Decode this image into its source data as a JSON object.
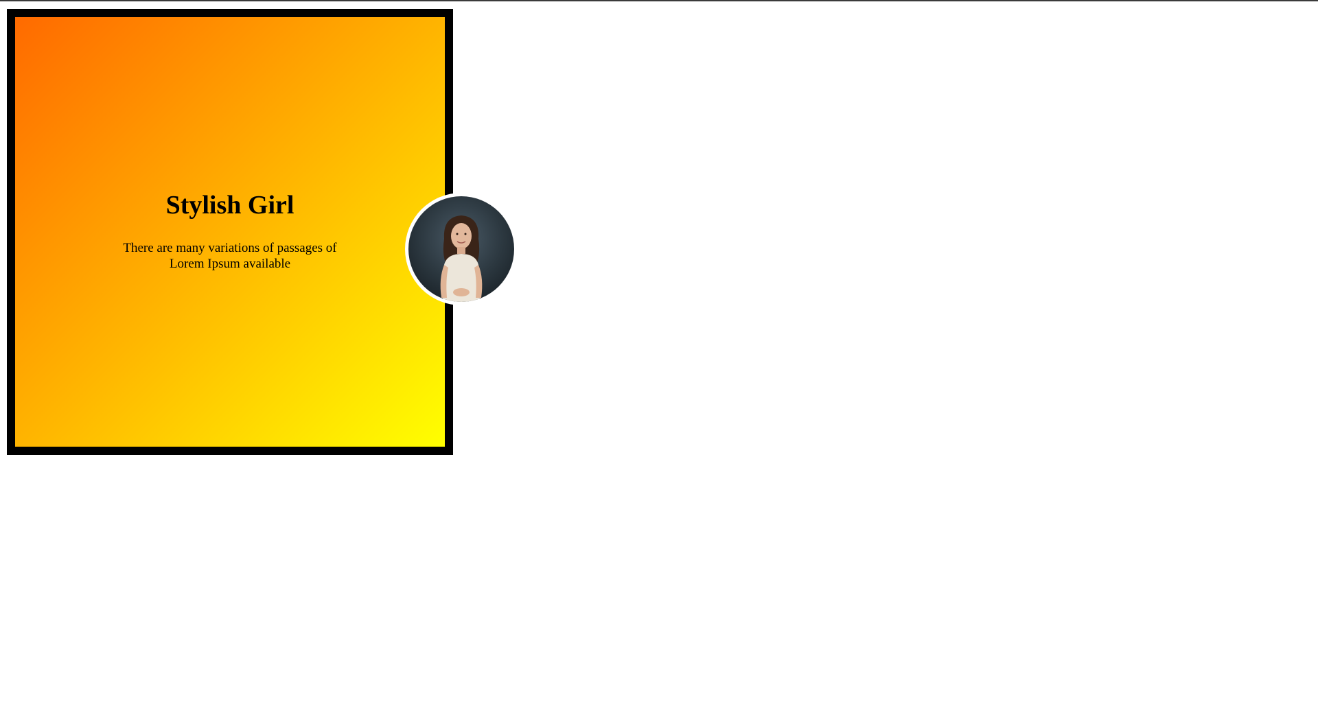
{
  "card": {
    "title": "Stylish Girl",
    "text": "There are many variations of passages of Lorem Ipsum available"
  },
  "colors": {
    "gradient_start": "#ff6a00",
    "gradient_end": "#ffff00",
    "border": "#000000"
  },
  "avatar": {
    "icon": "portrait-photo"
  }
}
